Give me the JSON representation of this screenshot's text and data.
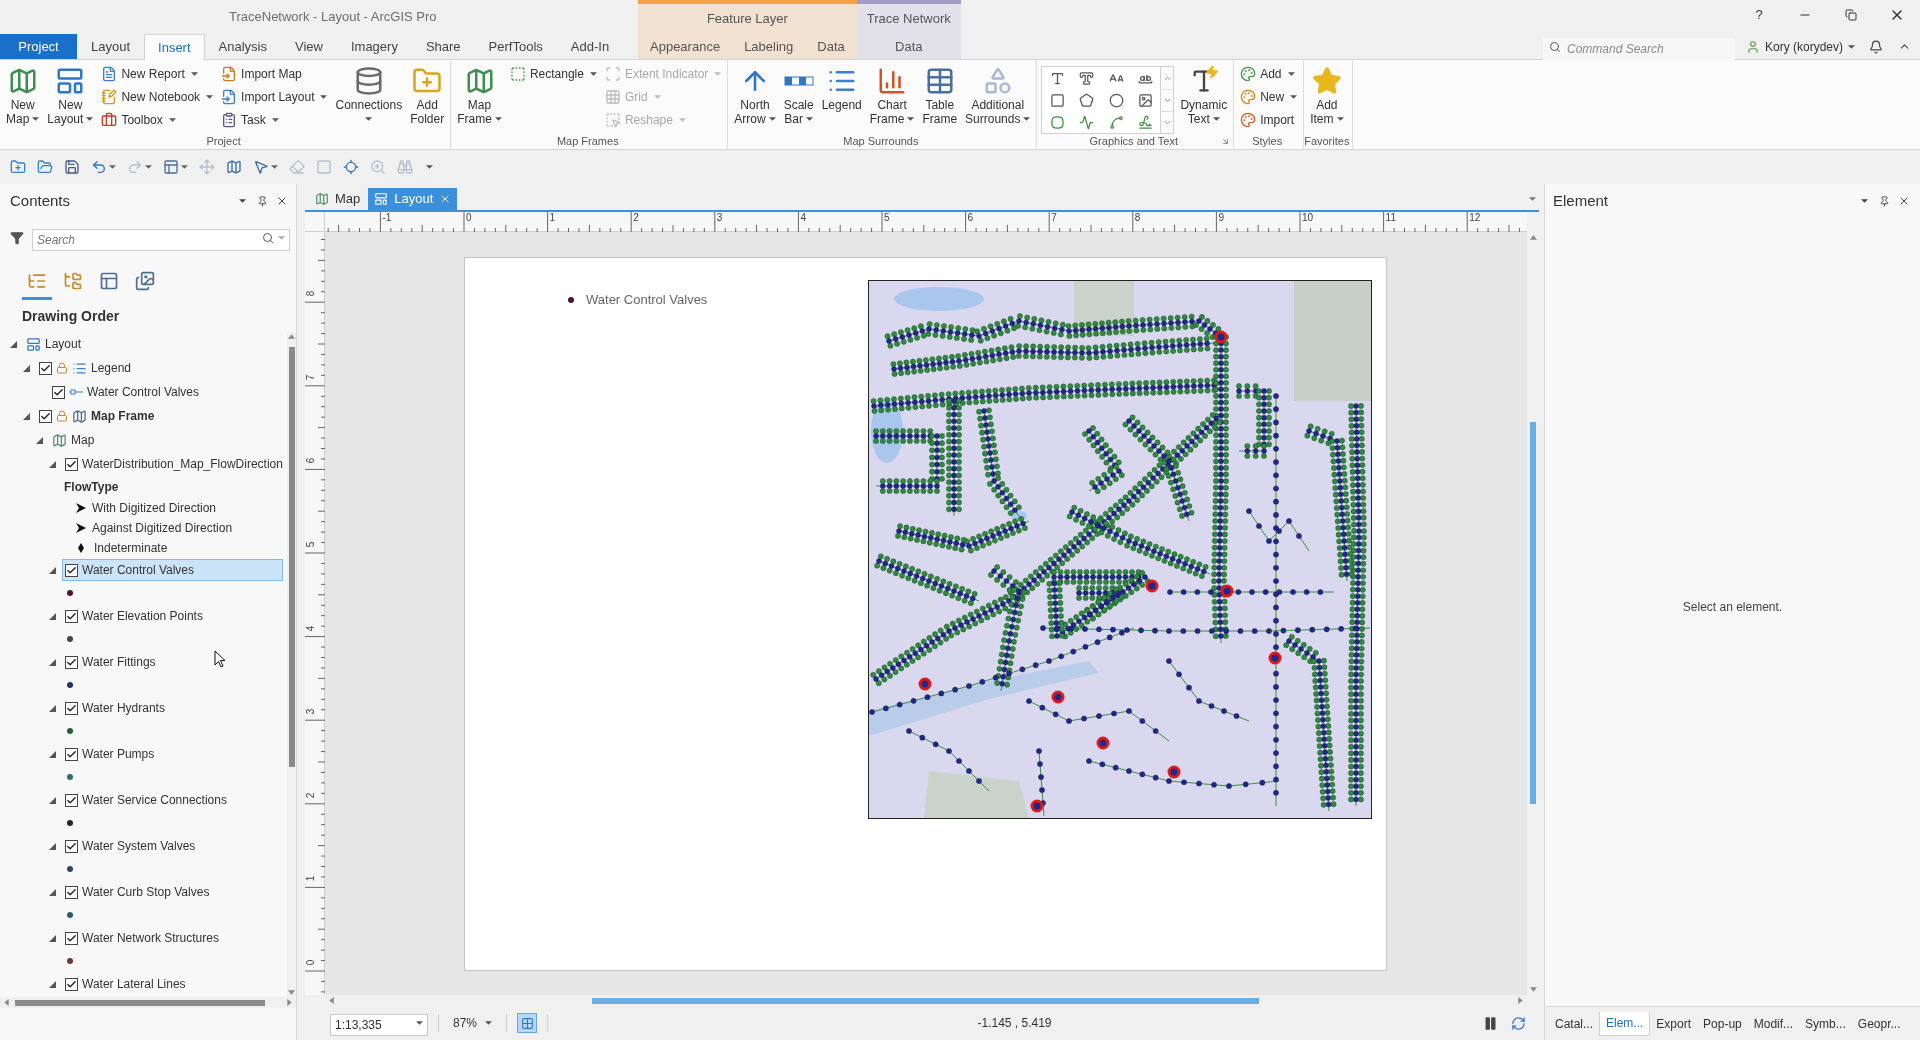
{
  "window": {
    "title": "TraceNetwork - Layout - ArcGIS Pro",
    "help": "?"
  },
  "tabs": [
    {
      "label": "Project",
      "kind": "backstage",
      "selected": false
    },
    {
      "label": "Layout",
      "kind": "tab",
      "selected": false
    },
    {
      "label": "Insert",
      "kind": "tab",
      "selected": true
    },
    {
      "label": "Analysis",
      "kind": "tab",
      "selected": false
    },
    {
      "label": "View",
      "kind": "tab",
      "selected": false
    },
    {
      "label": "Imagery",
      "kind": "tab",
      "selected": false
    },
    {
      "label": "Share",
      "kind": "tab",
      "selected": false
    },
    {
      "label": "PerfTools",
      "kind": "tab",
      "selected": false
    },
    {
      "label": "Add-In",
      "kind": "tab",
      "selected": false
    }
  ],
  "contextual_groups": [
    {
      "title": "Feature Layer",
      "color": "#f3a24a",
      "tabs": [
        {
          "label": "Appearance",
          "selected": false
        },
        {
          "label": "Labeling",
          "selected": false
        },
        {
          "label": "Data",
          "selected": false
        }
      ]
    },
    {
      "title": "Trace Network",
      "color": "#a49dc8",
      "tabs": [
        {
          "label": "Data",
          "selected": false
        }
      ]
    }
  ],
  "command_search": {
    "placeholder": "Command Search"
  },
  "user": {
    "name": "Kory (korydev)"
  },
  "ribbon": {
    "groups": [
      {
        "label": "Project",
        "launcher": false,
        "items": [
          {
            "kind": "large",
            "lines": [
              "New",
              "Map"
            ],
            "dropdown": true
          },
          {
            "kind": "large",
            "lines": [
              "New",
              "Layout"
            ],
            "dropdown": true
          },
          {
            "kind": "stack",
            "items": [
              {
                "label": "New Report",
                "dropdown": true,
                "disabled": false
              },
              {
                "label": "New Notebook",
                "dropdown": true,
                "disabled": false
              },
              {
                "label": "Toolbox",
                "dropdown": true,
                "disabled": false
              }
            ]
          },
          {
            "kind": "stack",
            "items": [
              {
                "label": "Import Map",
                "dropdown": false,
                "disabled": false
              },
              {
                "label": "Import Layout",
                "dropdown": true,
                "disabled": false
              },
              {
                "label": "Task",
                "dropdown": true,
                "disabled": false
              }
            ]
          },
          {
            "kind": "large",
            "lines": [
              "Connections"
            ],
            "dropdown": true
          },
          {
            "kind": "large",
            "lines": [
              "Add",
              "Folder"
            ],
            "dropdown": false
          }
        ]
      },
      {
        "label": "Map Frames",
        "launcher": false,
        "items": [
          {
            "kind": "large",
            "lines": [
              "Map",
              "Frame"
            ],
            "dropdown": true
          },
          {
            "kind": "stack",
            "items": [
              {
                "label": "Rectangle",
                "dropdown": true,
                "disabled": false
              }
            ]
          },
          {
            "kind": "stack",
            "items": [
              {
                "label": "Extent Indicator",
                "dropdown": true,
                "disabled": true
              },
              {
                "label": "Grid",
                "dropdown": true,
                "disabled": true
              },
              {
                "label": "Reshape",
                "dropdown": true,
                "disabled": true
              }
            ]
          }
        ]
      },
      {
        "label": "Map Surrounds",
        "launcher": false,
        "items": [
          {
            "kind": "large",
            "lines": [
              "North",
              "Arrow"
            ],
            "dropdown": true
          },
          {
            "kind": "large",
            "lines": [
              "Scale",
              "Bar"
            ],
            "dropdown": true
          },
          {
            "kind": "large",
            "lines": [
              "Legend"
            ],
            "dropdown": false
          },
          {
            "kind": "large",
            "lines": [
              "Chart",
              "Frame"
            ],
            "dropdown": true
          },
          {
            "kind": "large",
            "lines": [
              "Table",
              "Frame"
            ],
            "dropdown": false
          },
          {
            "kind": "large",
            "lines": [
              "Additional",
              "Surrounds"
            ],
            "dropdown": true
          }
        ]
      },
      {
        "label": "Graphics and Text",
        "launcher": true,
        "items": [
          {
            "kind": "gallery"
          },
          {
            "kind": "large",
            "lines": [
              "Dynamic",
              "Text"
            ],
            "dropdown": true
          }
        ]
      },
      {
        "label": "Styles",
        "launcher": false,
        "items": [
          {
            "kind": "stack",
            "items": [
              {
                "label": "Add",
                "dropdown": true,
                "disabled": false
              },
              {
                "label": "New",
                "dropdown": true,
                "disabled": false
              },
              {
                "label": "Import",
                "dropdown": false,
                "disabled": false
              }
            ]
          }
        ]
      },
      {
        "label": "Favorites",
        "launcher": false,
        "items": [
          {
            "kind": "large",
            "lines": [
              "Add",
              "Item"
            ],
            "dropdown": true
          }
        ]
      }
    ]
  },
  "quick_access": [
    {
      "disabled": false,
      "dropdown": false
    },
    {
      "disabled": false,
      "dropdown": false
    },
    {
      "disabled": false,
      "dropdown": false
    },
    {
      "disabled": false,
      "dropdown": true
    },
    {
      "disabled": true,
      "dropdown": true
    },
    {
      "disabled": false,
      "dropdown": true
    },
    {
      "disabled": true,
      "dropdown": false
    },
    {
      "disabled": false,
      "dropdown": false
    },
    {
      "disabled": false,
      "dropdown": true
    },
    {
      "disabled": true,
      "dropdown": false
    },
    {
      "disabled": true,
      "dropdown": false
    },
    {
      "disabled": false,
      "dropdown": false
    },
    {
      "disabled": true,
      "dropdown": false
    },
    {
      "disabled": true,
      "dropdown": false
    }
  ],
  "contents": {
    "title": "Contents",
    "search": {
      "placeholder": "Search"
    },
    "view_buttons": [
      {
        "selected": true
      },
      {
        "selected": false
      },
      {
        "selected": false
      },
      {
        "selected": false
      }
    ],
    "heading": "Drawing Order",
    "tree": [
      {
        "label": "Layout",
        "kind": "layout",
        "expanded": true,
        "selected": false,
        "children": [
          {
            "label": "Legend",
            "kind": "legend",
            "checked": true,
            "expanded": true,
            "selected": false,
            "children": [
              {
                "label": "Water Control Valves",
                "kind": "legend-item",
                "checked": true,
                "selected": false
              }
            ]
          },
          {
            "label": "Map Frame",
            "kind": "map-frame",
            "checked": true,
            "expanded": true,
            "selected": false,
            "children": [
              {
                "label": "Map",
                "kind": "map",
                "expanded": true,
                "selected": false,
                "children": [
                  {
                    "label": "WaterDistribution_Map_FlowDirection",
                    "checked": true,
                    "expanded": true,
                    "selected": false,
                    "symbols": [
                      {
                        "kind": "heading",
                        "label": "FlowType"
                      },
                      {
                        "kind": "arrow",
                        "label": "With Digitized Direction"
                      },
                      {
                        "kind": "arrow",
                        "label": "Against Digitized Direction"
                      },
                      {
                        "kind": "diamond",
                        "label": "Indeterminate"
                      }
                    ]
                  },
                  {
                    "label": "Water Control Valves",
                    "checked": true,
                    "expanded": true,
                    "selected": true,
                    "symbols": [
                      {
                        "kind": "dot",
                        "color": "#4d1526"
                      }
                    ]
                  },
                  {
                    "label": "Water Elevation Points",
                    "checked": true,
                    "expanded": true,
                    "selected": false,
                    "symbols": [
                      {
                        "kind": "dot",
                        "color": "#3d4a55"
                      }
                    ]
                  },
                  {
                    "label": "Water Fittings",
                    "checked": true,
                    "expanded": true,
                    "selected": false,
                    "symbols": [
                      {
                        "kind": "dot",
                        "color": "#262d6b"
                      }
                    ]
                  },
                  {
                    "label": "Water Hydrants",
                    "checked": true,
                    "expanded": true,
                    "selected": false,
                    "symbols": [
                      {
                        "kind": "dot",
                        "color": "#2e5b3b"
                      }
                    ]
                  },
                  {
                    "label": "Water Pumps",
                    "checked": true,
                    "expanded": true,
                    "selected": false,
                    "symbols": [
                      {
                        "kind": "dot",
                        "color": "#2a6a78"
                      }
                    ]
                  },
                  {
                    "label": "Water Service Connections",
                    "checked": true,
                    "expanded": true,
                    "selected": false,
                    "symbols": [
                      {
                        "kind": "dot",
                        "color": "#262626"
                      }
                    ]
                  },
                  {
                    "label": "Water System Valves",
                    "checked": true,
                    "expanded": true,
                    "selected": false,
                    "symbols": [
                      {
                        "kind": "dot",
                        "color": "#2c4866"
                      }
                    ]
                  },
                  {
                    "label": "Water Curb Stop Valves",
                    "checked": true,
                    "expanded": true,
                    "selected": false,
                    "symbols": [
                      {
                        "kind": "dot",
                        "color": "#2d5c6c"
                      }
                    ]
                  },
                  {
                    "label": "Water Network Structures",
                    "checked": true,
                    "expanded": true,
                    "selected": false,
                    "symbols": [
                      {
                        "kind": "dot",
                        "color": "#6b3838"
                      }
                    ]
                  },
                  {
                    "label": "Water Lateral Lines",
                    "checked": true,
                    "expanded": true,
                    "selected": false
                  }
                ]
              }
            ]
          }
        ]
      }
    ]
  },
  "view_tabs": [
    {
      "label": "Map",
      "kind": "map",
      "selected": false,
      "closable": false
    },
    {
      "label": "Layout",
      "kind": "layout",
      "selected": true,
      "closable": true
    }
  ],
  "rulers": {
    "horizontal": [
      "-1",
      "0",
      "1",
      "2",
      "3",
      "4",
      "5",
      "6",
      "7",
      "8",
      "9",
      "10",
      "11",
      "12"
    ],
    "vertical": [
      "8",
      "7",
      "6",
      "5",
      "4",
      "3",
      "2",
      "1",
      "0"
    ]
  },
  "page": {
    "legend": [
      {
        "label": "Water Control Valves",
        "color": "#4d1526"
      }
    ]
  },
  "element_pane": {
    "title": "Element",
    "message": "Select an element."
  },
  "status_bar": {
    "scale": "1:13,335",
    "zoom": "87%",
    "grid_toggle": {
      "on": true
    },
    "coordinates": "-1.145 , 5.419",
    "pane_tabs": [
      {
        "label": "Catal...",
        "selected": false
      },
      {
        "label": "Elem...",
        "selected": true
      },
      {
        "label": "Export",
        "selected": false
      },
      {
        "label": "Pop-up",
        "selected": false
      },
      {
        "label": "Modif...",
        "selected": false
      },
      {
        "label": "Symb...",
        "selected": false
      },
      {
        "label": "Geopr...",
        "selected": false
      }
    ]
  }
}
